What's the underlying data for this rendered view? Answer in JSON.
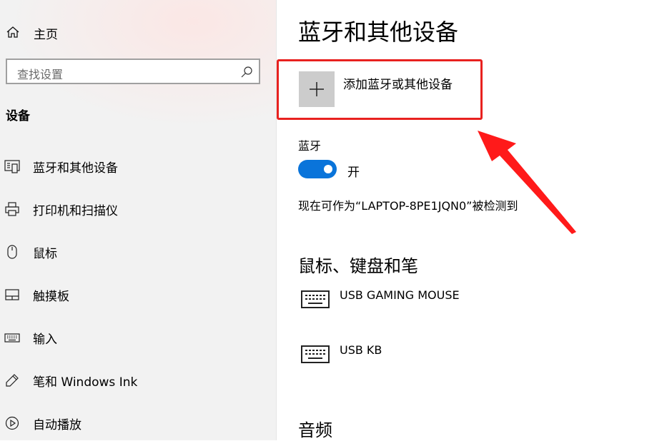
{
  "sidebar": {
    "home_label": "主页",
    "search_placeholder": "查找设置",
    "section_title": "设备",
    "items": [
      {
        "label": "蓝牙和其他设备",
        "icon": "bluetooth-devices-icon"
      },
      {
        "label": "打印机和扫描仪",
        "icon": "printer-icon"
      },
      {
        "label": "鼠标",
        "icon": "mouse-icon"
      },
      {
        "label": "触摸板",
        "icon": "touchpad-icon"
      },
      {
        "label": "输入",
        "icon": "keyboard-icon"
      },
      {
        "label": "笔和 Windows Ink",
        "icon": "pen-icon"
      },
      {
        "label": "自动播放",
        "icon": "autoplay-icon"
      }
    ]
  },
  "main": {
    "title": "蓝牙和其他设备",
    "add_device_label": "添加蓝牙或其他设备",
    "bluetooth": {
      "label": "蓝牙",
      "state": "开",
      "on": true,
      "discoverable_text": "现在可作为“LAPTOP-8PE1JQN0”被检测到"
    },
    "input_section_title": "鼠标、键盘和笔",
    "devices": [
      {
        "name": "USB GAMING MOUSE",
        "icon": "keyboard-icon"
      },
      {
        "name": "USB KB",
        "icon": "keyboard-icon"
      }
    ],
    "audio_section_title": "音频"
  },
  "annotation": {
    "box_color": "#e8211f",
    "arrow_color": "#ff1a1a"
  },
  "colors": {
    "accent": "#0a74da",
    "sidebar_bg": "#f2f2f2"
  }
}
